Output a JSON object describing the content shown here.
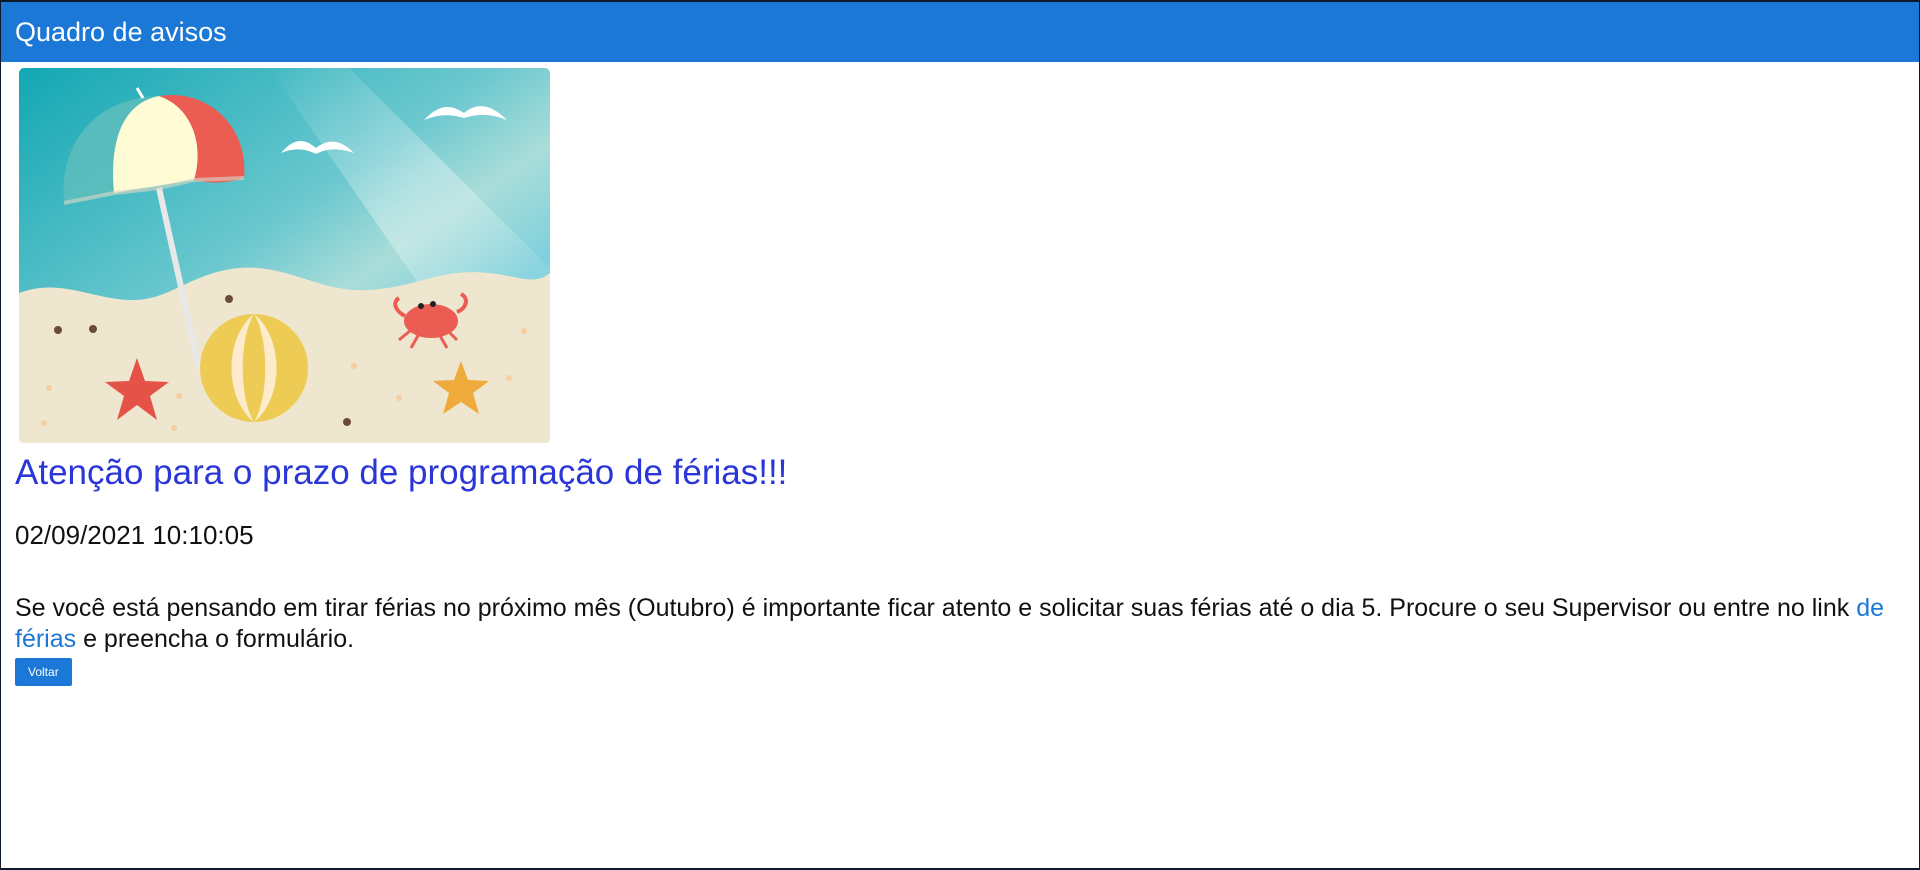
{
  "header": {
    "title": "Quadro de avisos"
  },
  "notice": {
    "image_icon": "beach-illustration",
    "title": "Atenção para o prazo de programação de férias!!!",
    "datetime": "02/09/2021 10:10:05",
    "body_before_link": "Se você está pensando em tirar férias no próximo mês (Outubro) é importante ficar atento e solicitar suas férias até o dia 5. Procure o seu Supervisor ou entre no link ",
    "link_text": "de férias",
    "body_after_link": " e preencha o formulário."
  },
  "actions": {
    "back_label": "Voltar"
  },
  "colors": {
    "header_bg": "#1b78d6",
    "title": "#2a36d8",
    "link": "#1b78d6",
    "button_bg": "#1b78d6"
  }
}
